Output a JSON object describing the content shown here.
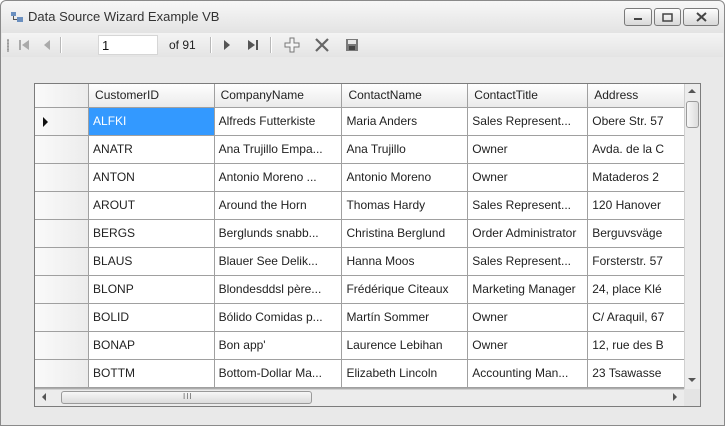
{
  "window": {
    "title": "Data Source Wizard Example VB",
    "icons": {
      "app": "datasource-app-icon",
      "minimize": "minimize-icon",
      "maximize": "maximize-icon",
      "close": "close-icon"
    }
  },
  "navigator": {
    "position": "1",
    "count_label": "of 91",
    "icons": [
      "move-first-icon",
      "move-previous-icon",
      "move-next-icon",
      "move-last-icon",
      "add-new-icon",
      "delete-icon",
      "save-icon"
    ]
  },
  "grid": {
    "columns": [
      "CustomerID",
      "CompanyName",
      "ContactName",
      "ContactTitle",
      "Address"
    ],
    "rows": [
      [
        "ALFKI",
        "Alfreds Futterkiste",
        "Maria Anders",
        "Sales Represent...",
        "Obere Str. 57"
      ],
      [
        "ANATR",
        "Ana Trujillo Empa...",
        "Ana Trujillo",
        "Owner",
        "Avda. de la C"
      ],
      [
        "ANTON",
        "Antonio Moreno ...",
        "Antonio Moreno",
        "Owner",
        "Mataderos  2"
      ],
      [
        "AROUT",
        "Around the Horn",
        "Thomas Hardy",
        "Sales Represent...",
        "120 Hanover"
      ],
      [
        "BERGS",
        "Berglunds snabb...",
        "Christina Berglund",
        "Order Administrator",
        "Berguvsväge"
      ],
      [
        "BLAUS",
        "Blauer See Delik...",
        "Hanna Moos",
        "Sales Represent...",
        "Forsterstr. 57"
      ],
      [
        "BLONP",
        "Blondesddsl père...",
        "Frédérique Citeaux",
        "Marketing Manager",
        "24, place Klé"
      ],
      [
        "BOLID",
        "Bólido Comidas p...",
        "Martín Sommer",
        "Owner",
        "C/ Araquil, 67"
      ],
      [
        "BONAP",
        "Bon app'",
        "Laurence Lebihan",
        "Owner",
        "12, rue des B"
      ],
      [
        "BOTTM",
        "Bottom-Dollar Ma...",
        "Elizabeth Lincoln",
        "Accounting Man...",
        "23 Tsawasse"
      ]
    ],
    "selected_row": 0,
    "scroll_grip": "III"
  }
}
